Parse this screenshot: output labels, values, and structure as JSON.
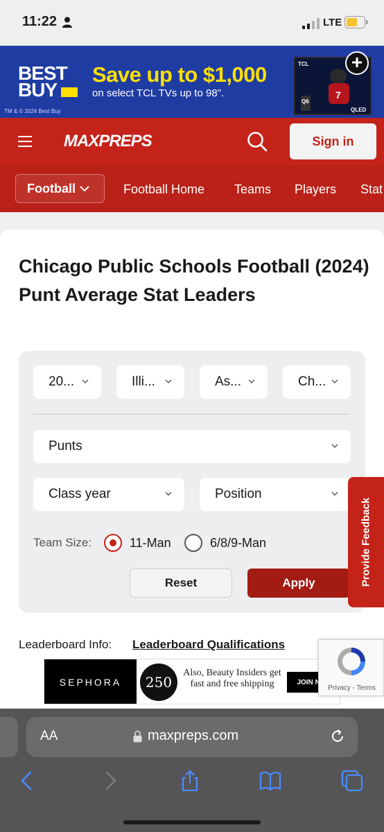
{
  "status_bar": {
    "time": "11:22",
    "network": "LTE",
    "battery_color": "#f4c430"
  },
  "ad_banner": {
    "brand_line1": "BEST",
    "brand_line2": "BUY",
    "headline": "Save up to $1,000",
    "subline": "on select TCL TVs up to 98\".",
    "legal": "TM & © 2024 Best Buy",
    "tv_brand": "TCL",
    "tv_model": "Q6",
    "tv_badge": "QLED"
  },
  "header": {
    "logo": "MAXPREPS",
    "signin_label": "Sign in",
    "brand_color": "#c4231a"
  },
  "sub_nav": {
    "sport_label": "Football",
    "links": [
      "Football Home",
      "Teams",
      "Players",
      "Stat"
    ]
  },
  "page": {
    "title": "Chicago Public Schools Football (2024) Punt Average Stat Leaders"
  },
  "filters": {
    "season": "20...",
    "state": "Illi...",
    "association": "As...",
    "league": "Ch...",
    "stat_category": "Punts",
    "class_year_placeholder": "Class year",
    "position_placeholder": "Position",
    "team_size_label": "Team Size:",
    "team_size_options": [
      "11-Man",
      "6/8/9-Man"
    ],
    "team_size_selected": "11-Man",
    "reset_label": "Reset",
    "apply_label": "Apply"
  },
  "feedback_tab": {
    "label": "Provide Feedback"
  },
  "leaderboard_info": {
    "label": "Leaderboard Info:",
    "link": "Leaderboard Qualifications"
  },
  "sephora_ad": {
    "brand": "SEPHORA",
    "points": "250",
    "text": "Also, Beauty Insiders get fast and free shipping",
    "cta": "JOIN NO"
  },
  "recaptcha": {
    "privacy": "Privacy",
    "separator": " - ",
    "terms": "Terms"
  },
  "safari": {
    "text_size": "AA",
    "url": "maxpreps.com"
  }
}
